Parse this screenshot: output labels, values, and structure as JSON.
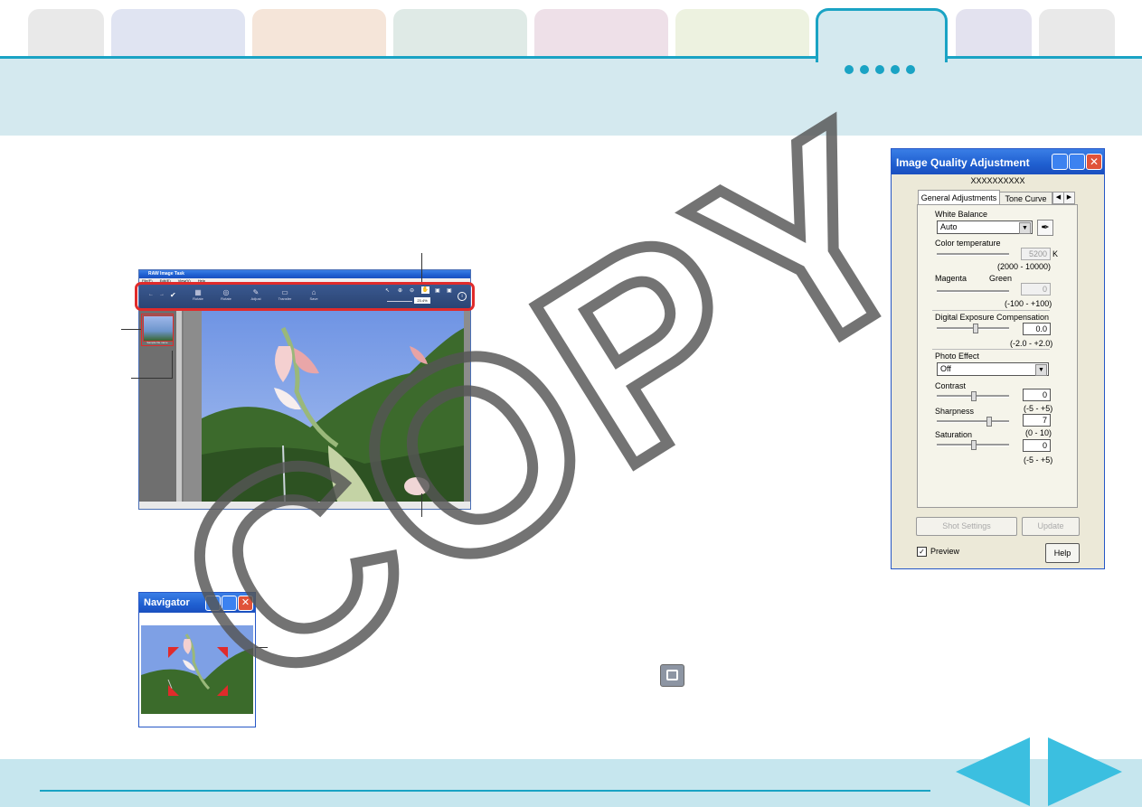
{
  "watermark": "COPY",
  "colors": {
    "accent": "#1aa3c4",
    "nav_arrow": "#3bbfe0",
    "highlight": "#e02b2b",
    "header_band": "#d4e9ef"
  },
  "nav_dots": 5,
  "main_window": {
    "title": "RAW Image Task",
    "menu": [
      "File(F)",
      "Edit(E)",
      "View(V)",
      "Help"
    ],
    "toolbar": [
      "Rotate",
      "Rotate",
      "Adjust",
      "Transfer",
      "Save"
    ],
    "zoom_value": "23.4%",
    "thumb_caption": "Sample file name"
  },
  "navigator": {
    "title": "Navigator"
  },
  "iqa": {
    "title": "Image Quality Adjustment",
    "file_label": "XXXXXXXXXX",
    "tabs": [
      "General Adjustments",
      "Tone Curve"
    ],
    "white_balance": {
      "label": "White Balance",
      "value": "Auto"
    },
    "color_temp": {
      "label": "Color temperature",
      "value": "5200",
      "unit": "K",
      "range": "(2000 - 10000)"
    },
    "magenta": {
      "left": "Magenta",
      "right": "Green",
      "value": "0",
      "range": "(-100 - +100)"
    },
    "dec": {
      "label": "Digital Exposure Compensation",
      "value": "0.0",
      "range": "(-2.0 - +2.0)"
    },
    "photo_effect": {
      "label": "Photo Effect",
      "value": "Off"
    },
    "contrast": {
      "label": "Contrast",
      "value": "0",
      "range": "(-5 - +5)"
    },
    "sharpness": {
      "label": "Sharpness",
      "value": "7",
      "range": "(0 - 10)"
    },
    "saturation": {
      "label": "Saturation",
      "value": "0",
      "range": "(-5 - +5)"
    },
    "buttons": {
      "shot_settings": "Shot Settings",
      "update": "Update",
      "help": "Help"
    },
    "preview": "Preview"
  }
}
